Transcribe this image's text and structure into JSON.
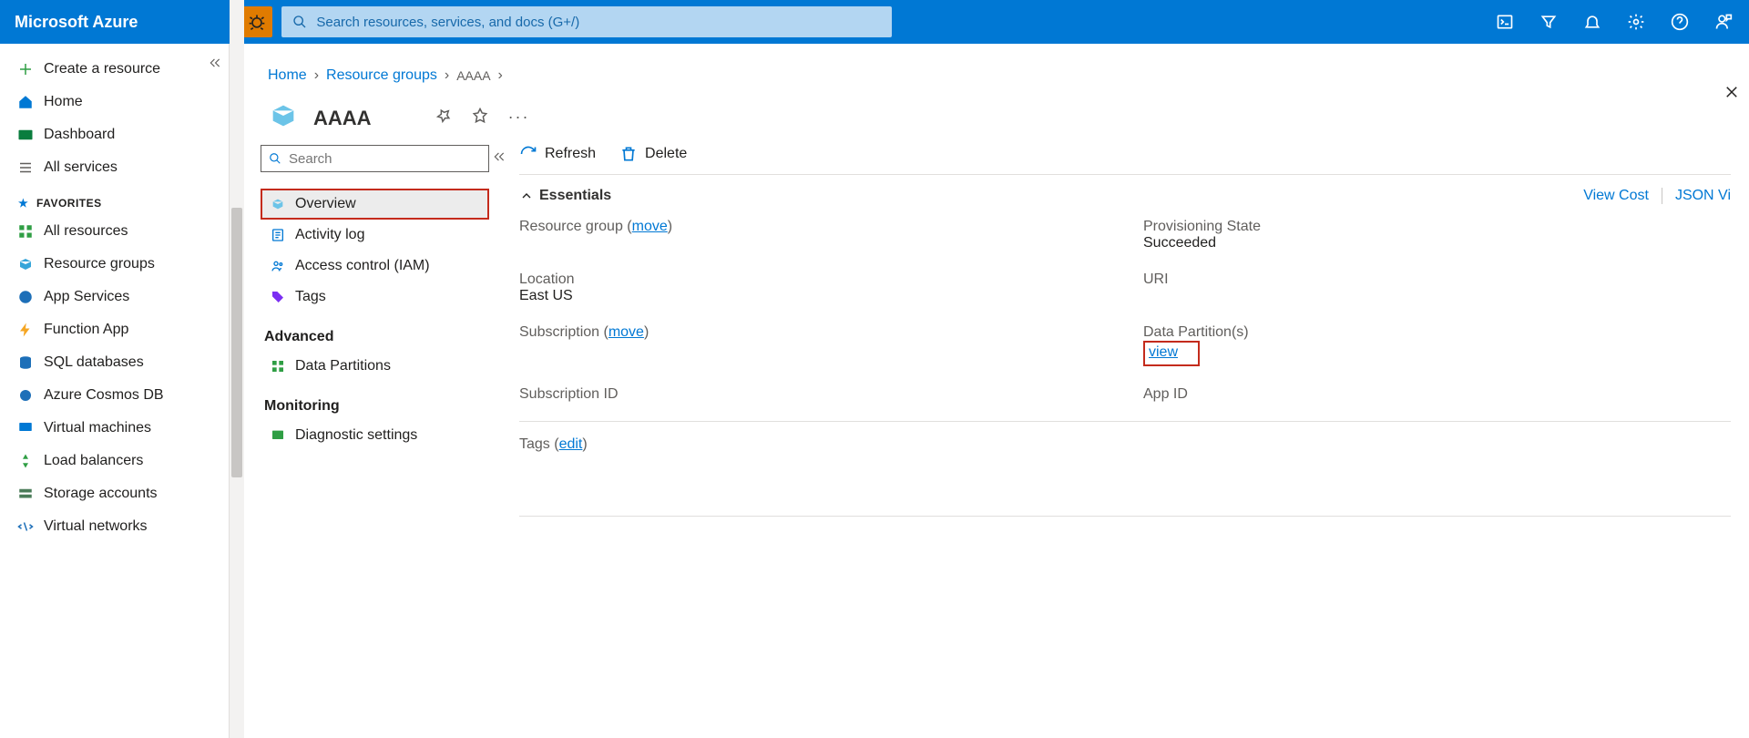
{
  "header": {
    "brand": "Microsoft Azure",
    "search_placeholder": "Search resources, services, and docs (G+/)"
  },
  "sidebar": {
    "create": "Create a resource",
    "home": "Home",
    "dashboard": "Dashboard",
    "all_services": "All services",
    "favorites_label": "FAVORITES",
    "items": [
      "All resources",
      "Resource groups",
      "App Services",
      "Function App",
      "SQL databases",
      "Azure Cosmos DB",
      "Virtual machines",
      "Load balancers",
      "Storage accounts",
      "Virtual networks"
    ]
  },
  "breadcrumb": {
    "home": "Home",
    "rg": "Resource groups",
    "leaf": "AAAA"
  },
  "resource": {
    "title": "AAAA",
    "search_placeholder": "Search",
    "menu": {
      "overview": "Overview",
      "activity": "Activity log",
      "iam": "Access control (IAM)",
      "tags": "Tags",
      "advanced_head": "Advanced",
      "data_partitions": "Data Partitions",
      "monitoring_head": "Monitoring",
      "diagnostic": "Diagnostic settings"
    }
  },
  "commands": {
    "refresh": "Refresh",
    "delete": "Delete"
  },
  "essentials": {
    "heading": "Essentials",
    "view_cost": "View Cost",
    "json_view": "JSON Vi",
    "rg_label": "Resource group",
    "move": "move",
    "location_label": "Location",
    "location_value": "East US",
    "subscription_label": "Subscription",
    "subscription_id_label": "Subscription ID",
    "prov_label": "Provisioning State",
    "prov_value": "Succeeded",
    "uri_label": "URI",
    "dp_label": "Data Partition(s)",
    "dp_view": "view",
    "appid_label": "App ID",
    "tags_label": "Tags",
    "edit": "edit"
  }
}
